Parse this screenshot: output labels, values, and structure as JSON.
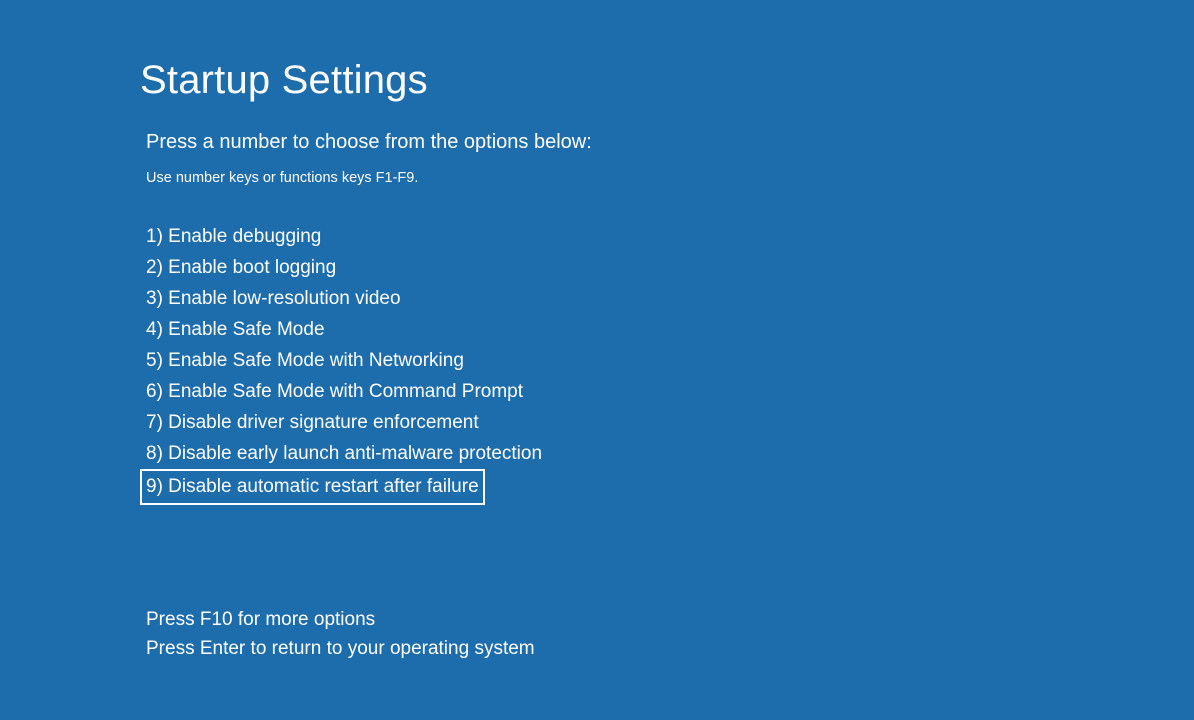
{
  "title": "Startup Settings",
  "subtitle": "Press a number to choose from the options below:",
  "hint": "Use number keys or functions keys F1-F9.",
  "options": [
    "1) Enable debugging",
    "2) Enable boot logging",
    "3) Enable low-resolution video",
    "4) Enable Safe Mode",
    "5) Enable Safe Mode with Networking",
    "6) Enable Safe Mode with Command Prompt",
    "7) Disable driver signature enforcement",
    "8) Disable early launch anti-malware protection",
    "9) Disable automatic restart after failure"
  ],
  "highlighted_index": 8,
  "footer": {
    "more_options": "Press F10 for more options",
    "return": "Press Enter to return to your operating system"
  }
}
